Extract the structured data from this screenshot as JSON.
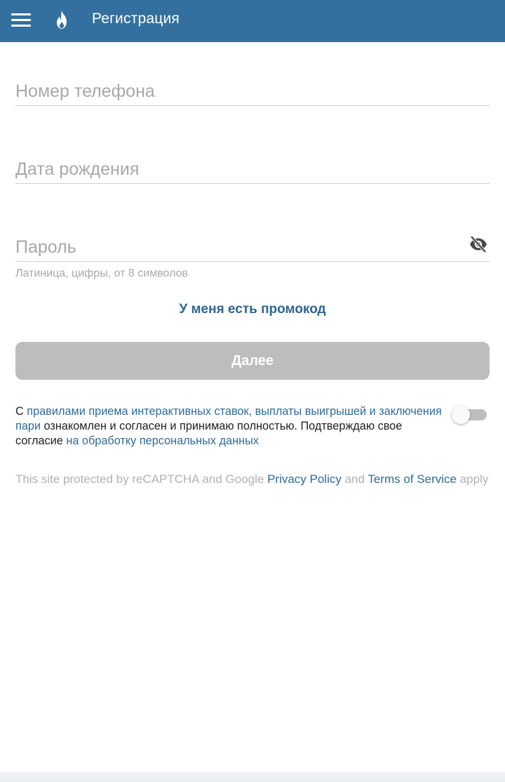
{
  "appbar": {
    "title": "Регистрация",
    "menu_icon": "hamburger-menu-icon",
    "logo_icon": "flame-icon",
    "color": "#33709f"
  },
  "form": {
    "phone_placeholder": "Номер телефона",
    "dob_placeholder": "Дата рождения",
    "password_placeholder": "Пароль",
    "password_hint": "Латиница, цифры, от 8 символов",
    "password_visibility_icon": "eye-off-icon",
    "promo_link": "У меня есть промокод",
    "next_button": "Далее"
  },
  "consent": {
    "prefix": "С ",
    "rules_link": "правилами приема интерактивных ставок, выплаты выигрышей и заключения пари",
    "middle": " ознакомлен и согласен и принимаю полностью. Подтверждаю свое согласие ",
    "personal_data_link": "на обработку персональных данных",
    "toggle_on": false
  },
  "recaptcha": {
    "prefix": "This site protected by reCAPTCHA and Google ",
    "privacy_link": "Privacy Policy",
    "and": " and ",
    "terms_link": "Terms of Service",
    "suffix": " apply"
  },
  "colors": {
    "accent": "#2f6b98",
    "disabled_button": "#bdbdbd",
    "muted_text": "#a8a8a8"
  }
}
